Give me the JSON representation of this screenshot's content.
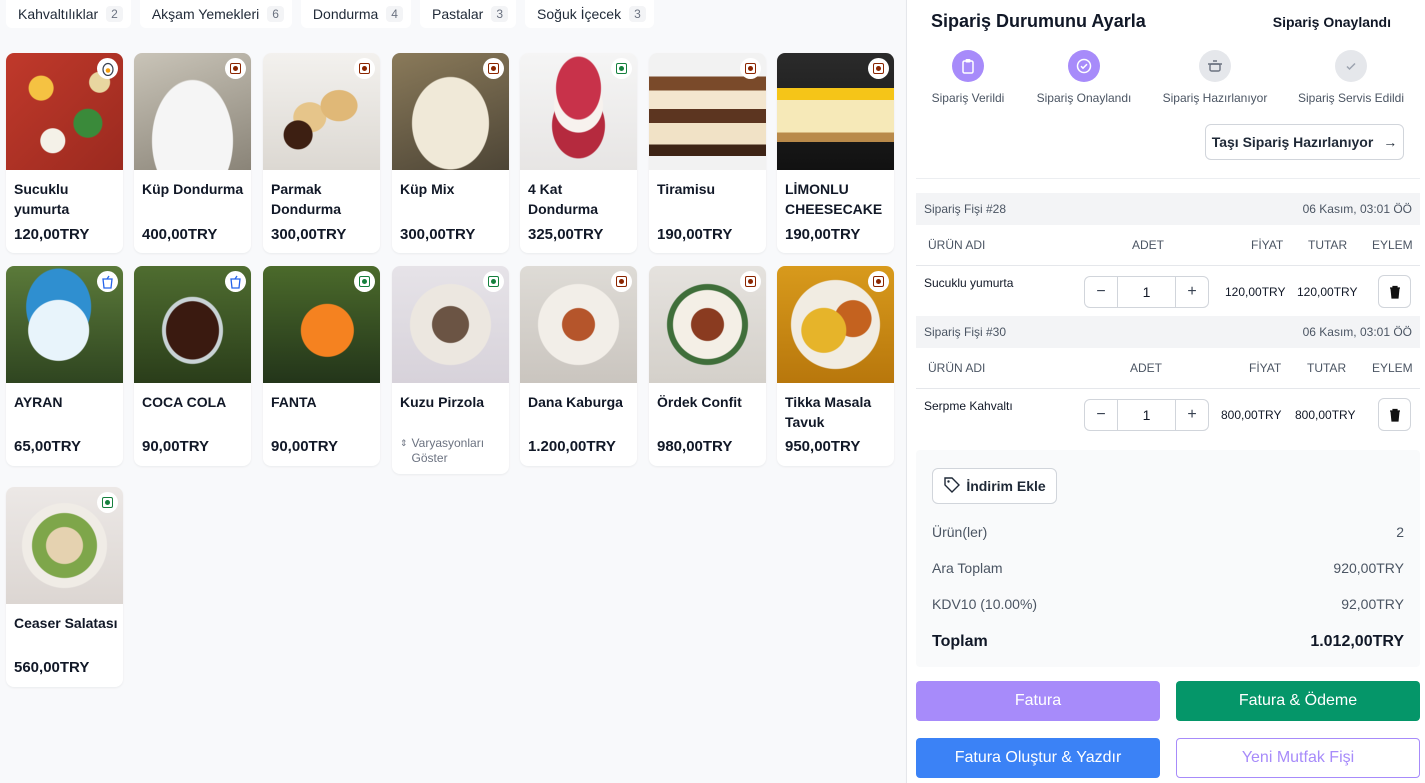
{
  "categories": [
    {
      "label": "Kahvaltılıklar",
      "count": "2"
    },
    {
      "label": "Akşam Yemekleri",
      "count": "6"
    },
    {
      "label": "Dondurma",
      "count": "4"
    },
    {
      "label": "Pastalar",
      "count": "3"
    },
    {
      "label": "Soğuk İçecek",
      "count": "3"
    }
  ],
  "products": [
    {
      "name": "Sucuklu yumurta",
      "price": "120,00TRY",
      "icon": "egg-icon"
    },
    {
      "name": "Küp Dondurma",
      "price": "400,00TRY",
      "icon": "non-veg-mark-icon"
    },
    {
      "name": "Parmak Dondurma",
      "price": "300,00TRY",
      "icon": "non-veg-mark-icon"
    },
    {
      "name": "Küp Mix",
      "price": "300,00TRY",
      "icon": "non-veg-mark-icon"
    },
    {
      "name": "4 Kat Dondurma",
      "price": "325,00TRY",
      "icon": "veg-mark-icon"
    },
    {
      "name": "Tiramisu",
      "price": "190,00TRY",
      "icon": "non-veg-mark-icon"
    },
    {
      "name": "LİMONLU CHEESECAKE",
      "price": "190,00TRY",
      "icon": "non-veg-mark-icon"
    },
    {
      "name": "AYRAN",
      "price": "65,00TRY",
      "icon": "drink-icon"
    },
    {
      "name": "COCA COLA",
      "price": "90,00TRY",
      "icon": "drink-icon"
    },
    {
      "name": "FANTA",
      "price": "90,00TRY",
      "icon": "veg-mark-icon"
    },
    {
      "name": "Kuzu Pirzola",
      "price": "",
      "icon": "veg-mark-icon",
      "variation": "Varyasyonları Göster"
    },
    {
      "name": "Dana Kaburga",
      "price": "1.200,00TRY",
      "icon": "non-veg-mark-icon"
    },
    {
      "name": "Ördek Confit",
      "price": "980,00TRY",
      "icon": "non-veg-mark-icon"
    },
    {
      "name": "Tikka Masala Tavuk",
      "price": "950,00TRY",
      "icon": "non-veg-mark-icon"
    },
    {
      "name": "Ceaser Salatası",
      "price": "560,00TRY",
      "icon": "veg-mark-icon"
    }
  ],
  "order": {
    "title": "Sipariş Durumunu Ayarla",
    "status": "Sipariş Onaylandı",
    "steps": [
      "Sipariş Verildi",
      "Sipariş Onaylandı",
      "Sipariş Hazırlanıyor",
      "Sipariş Servis Edildi"
    ],
    "move_button": "Taşı Sipariş Hazırlanıyor",
    "headers": {
      "name": "ÜRÜN ADI",
      "qty": "ADET",
      "price": "FİYAT",
      "total": "TUTAR",
      "action": "EYLEM"
    },
    "receipts": [
      {
        "title": "Sipariş Fişi #28",
        "date": "06 Kasım, 03:01 ÖÖ",
        "item": "Sucuklu yumurta",
        "qty": "1",
        "price": "120,00TRY",
        "total": "120,00TRY"
      },
      {
        "title": "Sipariş Fişi #30",
        "date": "06 Kasım, 03:01 ÖÖ",
        "item": "Serpme Kahvaltı",
        "qty": "1",
        "price": "800,00TRY",
        "total": "800,00TRY"
      }
    ],
    "discount_button": "İndirim Ekle",
    "summary": {
      "items_label": "Ürün(ler)",
      "items_value": "2",
      "subtotal_label": "Ara Toplam",
      "subtotal_value": "920,00TRY",
      "tax_label": "KDV10 (10.00%)",
      "tax_value": "92,00TRY",
      "total_label": "Toplam",
      "total_value": "1.012,00TRY"
    },
    "actions": {
      "invoice": "Fatura",
      "invoice_pay": "Fatura & Ödeme",
      "invoice_print": "Fatura Oluştur & Yazdır",
      "kitchen": "Yeni Mutfak Fişi"
    }
  },
  "colors": {
    "accent_purple": "#a78bfa",
    "green": "#059669",
    "blue": "#3b82f6",
    "kitchen_text": "#a78bfa"
  }
}
